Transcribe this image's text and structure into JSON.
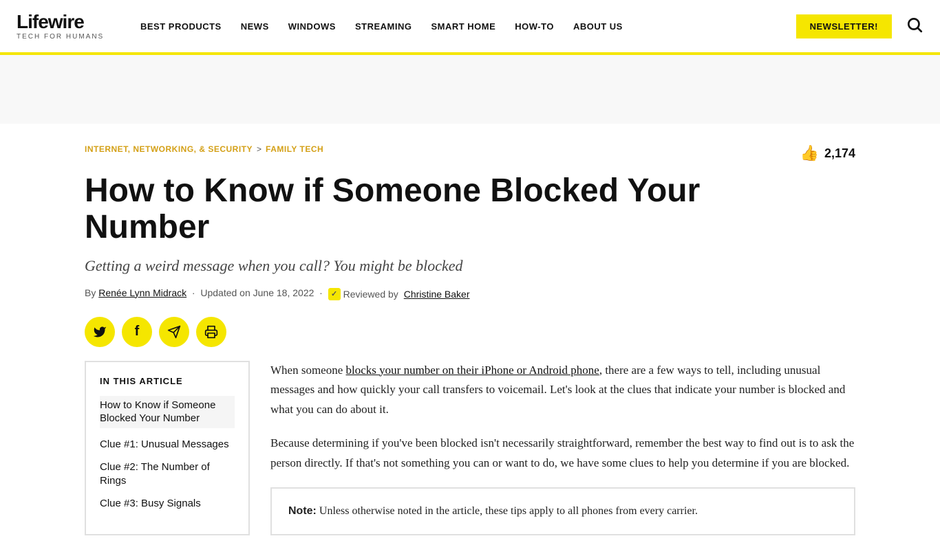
{
  "header": {
    "logo": "Lifewire",
    "tagline": "TECH FOR HUMANS",
    "nav": [
      {
        "label": "BEST PRODUCTS",
        "id": "best-products"
      },
      {
        "label": "NEWS",
        "id": "news"
      },
      {
        "label": "WINDOWS",
        "id": "windows"
      },
      {
        "label": "STREAMING",
        "id": "streaming"
      },
      {
        "label": "SMART HOME",
        "id": "smart-home"
      },
      {
        "label": "HOW-TO",
        "id": "how-to"
      },
      {
        "label": "ABOUT US",
        "id": "about-us"
      }
    ],
    "newsletter_btn": "NEWSLETTER!",
    "search_icon": "🔍"
  },
  "breadcrumb": {
    "items": [
      {
        "label": "INTERNET, NETWORKING, & SECURITY",
        "id": "internet"
      },
      {
        "label": "FAMILY TECH",
        "id": "family-tech"
      }
    ],
    "separator": ">"
  },
  "article": {
    "like_count": "2,174",
    "title": "How to Know if Someone Blocked Your Number",
    "subtitle": "Getting a weird message when you call? You might be blocked",
    "byline": "By",
    "author": "Renée Lynn Midrack",
    "updated": "Updated on June 18, 2022",
    "reviewed_prefix": "Reviewed by",
    "reviewer": "Christine Baker",
    "toc": {
      "heading": "IN THIS ARTICLE",
      "items": [
        {
          "label": "How to Know if Someone Blocked Your Number"
        },
        {
          "label": "Clue #1: Unusual Messages"
        },
        {
          "label": "Clue #2: The Number of Rings"
        },
        {
          "label": "Clue #3: Busy Signals"
        }
      ]
    },
    "body": [
      {
        "type": "paragraph",
        "link_text": "blocks your number on their iPhone or Android phone",
        "before": "When someone ",
        "after": ", there are a few ways to tell, including unusual messages and how quickly your call transfers to voicemail. Let's look at the clues that indicate your number is blocked and what you can do about it."
      },
      {
        "type": "paragraph",
        "text": "Because determining if you've been blocked isn't necessarily straightforward, remember the best way to find out is to ask the person directly. If that's not something you can or want to do, we have some clues to help you determine if you are blocked."
      },
      {
        "type": "note",
        "label": "Note:",
        "text": "Unless otherwise noted in the article, these tips apply to all phones from every carrier."
      }
    ]
  },
  "social": {
    "buttons": [
      {
        "icon": "🐦",
        "label": "Twitter",
        "name": "twitter"
      },
      {
        "icon": "f",
        "label": "Facebook",
        "name": "facebook"
      },
      {
        "icon": "✈",
        "label": "Telegram",
        "name": "telegram"
      },
      {
        "icon": "🖨",
        "label": "Print",
        "name": "print"
      }
    ]
  }
}
